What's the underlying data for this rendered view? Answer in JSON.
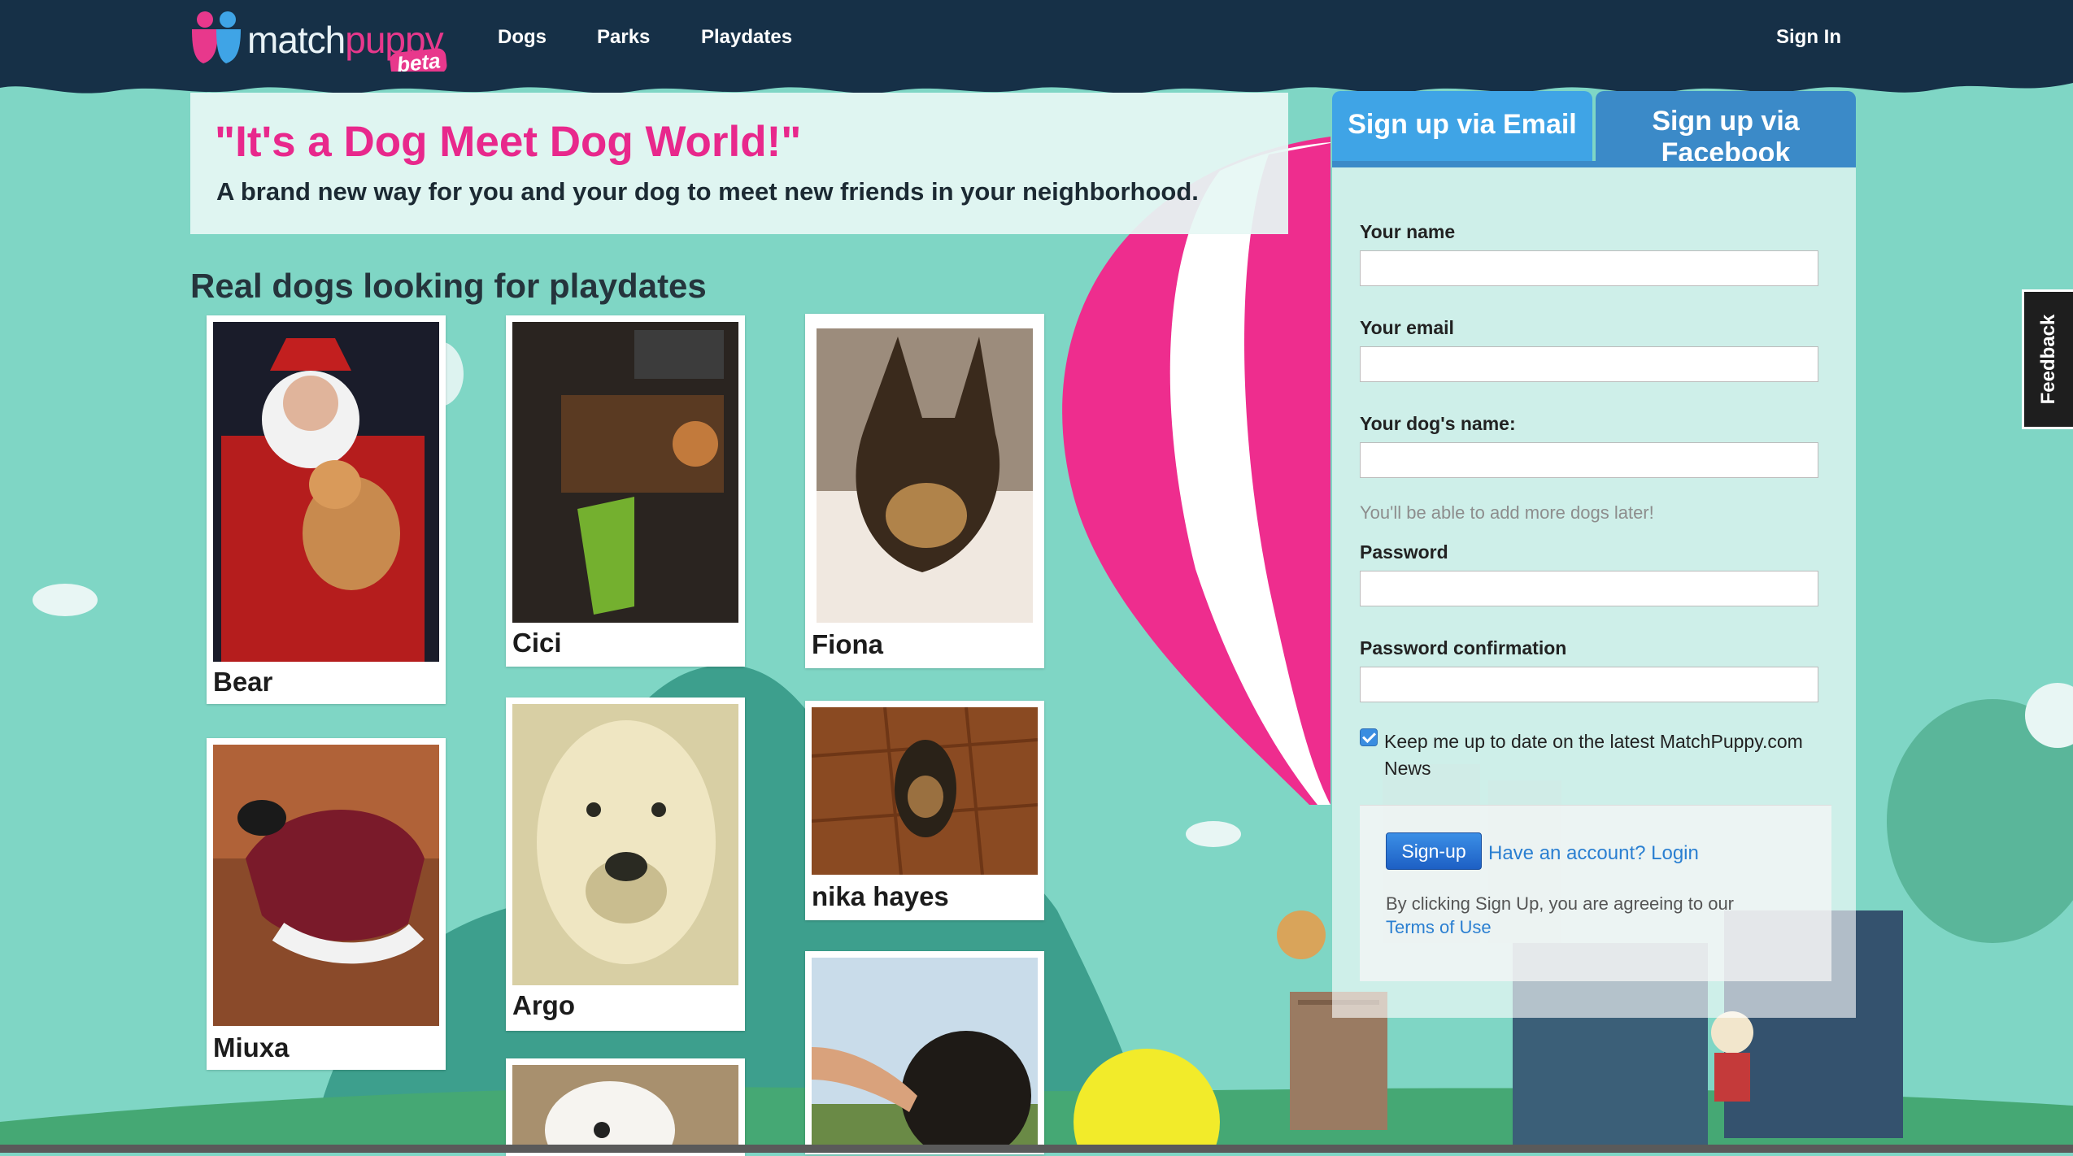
{
  "nav": {
    "logo_prefix": "match",
    "logo_suffix": "puppy",
    "logo_badge": "beta",
    "links": [
      "Dogs",
      "Parks",
      "Playdates"
    ],
    "sign_in": "Sign In"
  },
  "hero": {
    "title": "\"It's a Dog Meet Dog World!\"",
    "subtitle": "A brand new way for you and your dog to meet new friends in your neighborhood."
  },
  "dogs_section": {
    "title": "Real dogs looking for playdates",
    "dogs": [
      {
        "name": "Bear"
      },
      {
        "name": "Cici"
      },
      {
        "name": "Fiona"
      },
      {
        "name": "Miuxa"
      },
      {
        "name": "Argo"
      },
      {
        "name": "nika hayes"
      },
      {
        "name": ""
      },
      {
        "name": ""
      }
    ]
  },
  "signup": {
    "tab_email": "Sign up via Email",
    "tab_facebook": "Sign up via Facebook",
    "name_label": "Your name",
    "email_label": "Your email",
    "dog_name_label": "Your dog's name:",
    "dog_hint": "You'll be able to add more dogs later!",
    "password_label": "Password",
    "password_confirm_label": "Password confirmation",
    "newsletter_label": "Keep me up to date on the latest MatchPuppy.com News",
    "newsletter_checked": true,
    "signup_button": "Sign-up",
    "login_link": "Have an account? Login",
    "terms_text": "By clicking Sign Up, you are agreeing to our",
    "terms_link": "Terms of Use"
  },
  "feedback": "Feedback",
  "colors": {
    "accent_pink": "#e8288c",
    "nav_bg": "#163047",
    "background": "#7fd6c5",
    "tab_blue": "#3fa4e6",
    "link_blue": "#2a7fd1"
  }
}
